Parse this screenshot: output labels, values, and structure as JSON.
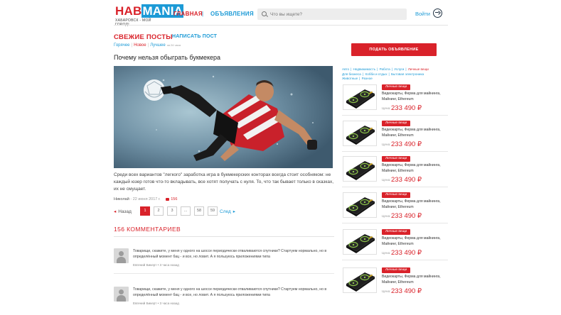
{
  "header": {
    "logo_part1": "HAB",
    "logo_part2": "MANIA",
    "logo_subtitle": "ХАБАРОВСК - МОЙ ГОРОД!",
    "nav_main": "ГЛАВНАЯ",
    "nav_separator": "|",
    "nav_ads": "ОБЪЯВЛЕНИЯ",
    "search_placeholder": "Что вы ищете?",
    "login_label": "Войти"
  },
  "main": {
    "section_title": "СВЕЖИЕ ПОСТЫ",
    "write_post": "НАПИСАТЬ ПОСТ",
    "filters": [
      "Горячее",
      "Новое",
      "Лучшее"
    ],
    "active_filter": "Новое",
    "filter_period": "за 24 часа",
    "post": {
      "title": "Почему нельзя обыграть букмекера",
      "text": "Среди всех вариантов \"легкого\" заработка игра в букмекерских конторах всегда стоит особняком: не каждый юзер готов что-то вкладывать, все хотят получать с нуля. То, что так бывает только в сказках, их не смущает.",
      "author": "Николай",
      "date": "- 22 июня 2017 г.",
      "comments_count": "156"
    },
    "pagination": {
      "prev": "Назад",
      "next": "След",
      "pages": [
        "1",
        "2",
        "3",
        "...",
        "58",
        "59"
      ],
      "current": "1"
    },
    "comments_title": "156 КОММЕНТАРИЕВ",
    "comments": [
      {
        "text": "Товарищи, скажите, у меня у одного на шоссе периодически отваливаются спутники? Стартуем нормально, но в определённый момент бац - и все, но ловит. А я пользуюсь приложениями типа",
        "meta": "Евгений Бикерт • 3 часа назад"
      },
      {
        "text": "Товарищи, скажите, у меня у одного на шоссе периодически отваливаются спутники? Стартуем нормально, но в определённый момент бац - и все, но ловит. А я пользуюсь приложениями типа",
        "meta": "Евгений Бикерт • 3 часа назад"
      }
    ]
  },
  "sidebar": {
    "ad_button": "ПОДАТЬ ОБЪЯВЛЕНИЕ",
    "categories": [
      "Авто",
      "Недвижимость",
      "Работа",
      "Услуги",
      "Личные вещи",
      "Для бизнеса",
      "Хобби и отдых",
      "Бытовая электроника",
      "Животные",
      "Разное"
    ],
    "active_category": "Личные вещи",
    "ads": [
      {
        "badge": "Личные вещи",
        "title": "Видеокарты, Ферма для майнинга, Майнинг, Ethereum",
        "price_label": "Цена:",
        "price": "233 490 ₽"
      },
      {
        "badge": "Личные вещи",
        "title": "Видеокарты, Ферма для майнинга, Майнинг, Ethereum",
        "price_label": "Цена:",
        "price": "233 490 ₽"
      },
      {
        "badge": "Личные вещи",
        "title": "Видеокарты, Ферма для майнинга, Майнинг, Ethereum",
        "price_label": "Цена:",
        "price": "233 490 ₽"
      },
      {
        "badge": "Личные вещи",
        "title": "Видеокарты, Ферма для майнинга, Майнинг, Ethereum",
        "price_label": "Цена:",
        "price": "233 490 ₽"
      },
      {
        "badge": "Личные вещи",
        "title": "Видеокарты, Ферма для майнинга, Майнинг, Ethereum",
        "price_label": "Цена:",
        "price": "233 490 ₽"
      },
      {
        "badge": "Личные вещи",
        "title": "Видеокарты, Ферма для майнинга, Майнинг, Ethereum",
        "price_label": "Цена:",
        "price": "233 490 ₽"
      }
    ]
  },
  "colors": {
    "accent_red": "#d9222a",
    "accent_blue": "#1c9ad6"
  }
}
